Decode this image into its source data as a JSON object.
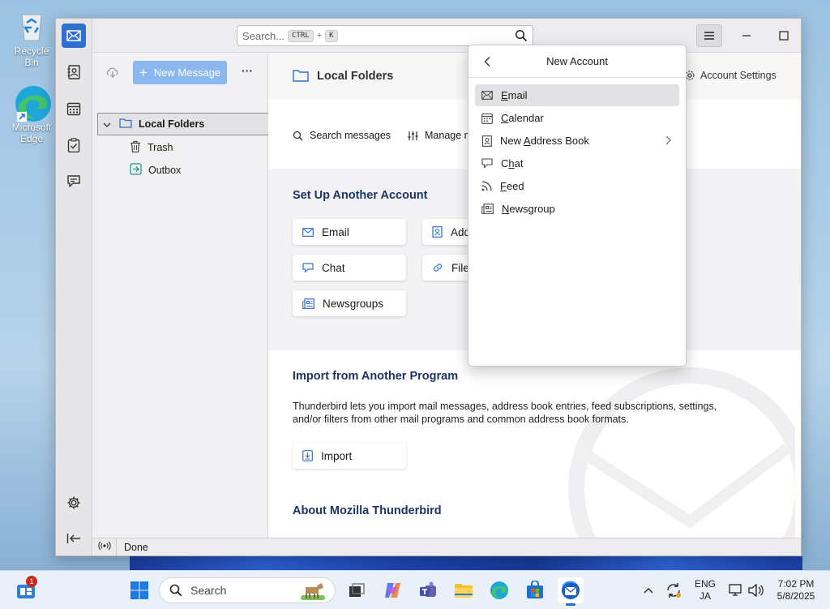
{
  "desktop": {
    "recycle_bin": "Recycle Bin",
    "edge_line1": "Microsoft",
    "edge_line2": "Edge"
  },
  "titlebar": {
    "search_placeholder": "Search...",
    "kbd_ctrl": "CTRL",
    "kbd_plus": "+",
    "kbd_k": "K"
  },
  "folder_pane": {
    "new_message": "New Message",
    "more": "···",
    "folders": [
      {
        "label": "Local Folders"
      },
      {
        "label": "Trash"
      },
      {
        "label": "Outbox"
      }
    ]
  },
  "main": {
    "header_title": "Local Folders",
    "account_settings": "Account Settings",
    "search_messages": "Search messages",
    "manage": "Manage m",
    "setup_title": "Set Up Another Account",
    "cards": {
      "email": "Email",
      "chat": "Chat",
      "newsgroups": "Newsgroups",
      "address": "Add",
      "file": "File"
    },
    "import_title": "Import from Another Program",
    "import_text": "Thunderbird lets you import mail messages, address book entries, feed subscriptions, settings, and/or filters from other mail programs and common address book formats.",
    "import_button": "Import",
    "about_title": "About Mozilla Thunderbird"
  },
  "statusbar": {
    "text": "Done"
  },
  "popup": {
    "title": "New Account",
    "items": [
      {
        "label": "Email",
        "u": "E",
        "rest": "mail"
      },
      {
        "label": "Calendar",
        "u": "C",
        "rest": "alendar"
      },
      {
        "label": "New Address Book",
        "u": "A",
        "pre": "New ",
        "rest": "ddress Book"
      },
      {
        "label": "Chat",
        "pre": "C",
        "u": "h",
        "rest": "at"
      },
      {
        "label": "Feed",
        "u": "F",
        "rest": "eed"
      },
      {
        "label": "Newsgroup",
        "u": "N",
        "rest": "ewsgroup"
      }
    ]
  },
  "taskbar": {
    "search": "Search",
    "badge": "1",
    "lang1": "ENG",
    "lang2": "JA",
    "time": "7:02 PM",
    "date": "5/8/2025"
  },
  "colors": {
    "accent": "#2f6fd0",
    "title_blue": "#1b3566",
    "new_message_bg": "#8ab8ee"
  }
}
